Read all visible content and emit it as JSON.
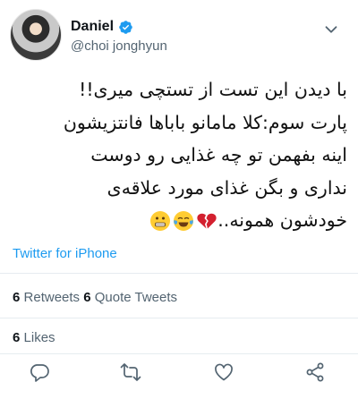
{
  "user": {
    "display_name": "Daniel",
    "handle": "@choi jonghyun",
    "verified": true
  },
  "tweet": {
    "lines": [
      "با دیدن این تست از تستچی میری!!",
      "پارت سوم:کلا مامانو باباها فانتزیشون",
      "اینه بفهمن تو چه غذایی رو دوست",
      "نداری و بگن غذای مورد علاقه‌ی",
      "خودشون همونه.."
    ],
    "emojis": [
      "broken-heart-emoji",
      "tears-of-joy-emoji",
      "grimacing-emoji"
    ]
  },
  "source": "Twitter for iPhone",
  "stats": {
    "retweets_count": "6",
    "retweets_label": "Retweets",
    "quotes_count": "6",
    "quotes_label": "Quote Tweets",
    "likes_count": "6",
    "likes_label": "Likes"
  },
  "colors": {
    "link": "#1d9bf0",
    "secondary_text": "#536471",
    "divider": "#e6ecf0"
  },
  "actions": [
    "reply-icon",
    "retweet-icon",
    "like-icon",
    "share-icon"
  ]
}
